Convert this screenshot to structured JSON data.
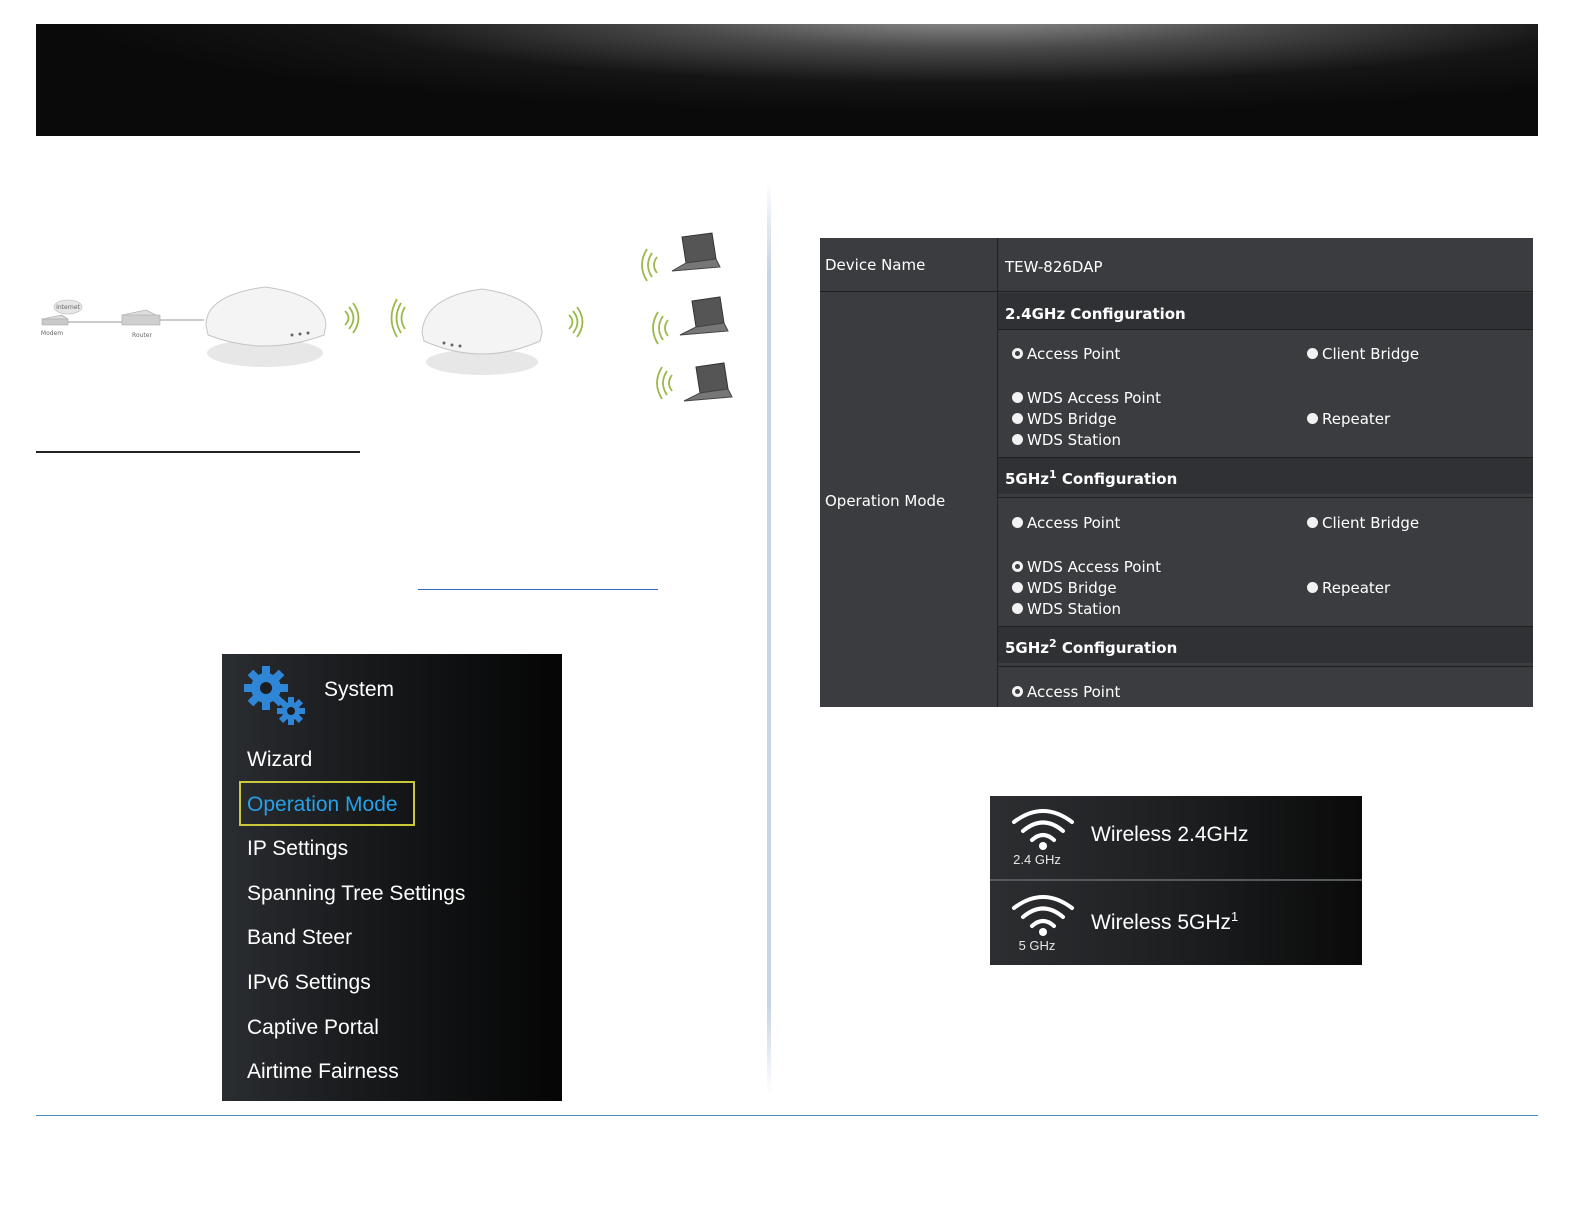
{
  "diagram": {
    "cloud_label": "Internet",
    "modem_label": "Modem",
    "router_label": "Router"
  },
  "system_menu": {
    "title": "System",
    "items": [
      "Wizard",
      "Operation Mode",
      "IP Settings",
      "Spanning Tree Settings",
      "Band Steer",
      "IPv6 Settings",
      "Captive Portal",
      "Airtime Fairness"
    ],
    "active_item": "Operation Mode"
  },
  "operation_table": {
    "device_name_label": "Device Name",
    "device_name_value": "TEW-826DAP",
    "operation_mode_label": "Operation Mode",
    "sections": [
      {
        "title": "2.4GHz",
        "sup": "",
        "suffix": " Configuration",
        "options": [
          "Access Point",
          "Client Bridge",
          "WDS Access Point",
          "WDS Bridge",
          "WDS Station",
          "Repeater"
        ],
        "selected": "Access Point"
      },
      {
        "title": "5GHz",
        "sup": "1",
        "suffix": " Configuration",
        "options": [
          "Access Point",
          "Client Bridge",
          "WDS Access Point",
          "WDS Bridge",
          "WDS Station",
          "Repeater"
        ],
        "selected": "WDS Access Point"
      },
      {
        "title": "5GHz",
        "sup": "2",
        "suffix": " Configuration",
        "options": [
          "Access Point"
        ],
        "selected": "Access Point"
      }
    ]
  },
  "wireless_menu": {
    "items": [
      {
        "band": "2.4 GHz",
        "label": "Wireless 2.4GHz",
        "sup": ""
      },
      {
        "band": "5 GHz",
        "label": "Wireless 5GHz",
        "sup": "1"
      }
    ]
  },
  "colors": {
    "active_menu": "#27a0e6",
    "highlight_box": "#c8c83a",
    "table_bg": "#3b3c40",
    "footer_line": "#4a8bc4"
  }
}
